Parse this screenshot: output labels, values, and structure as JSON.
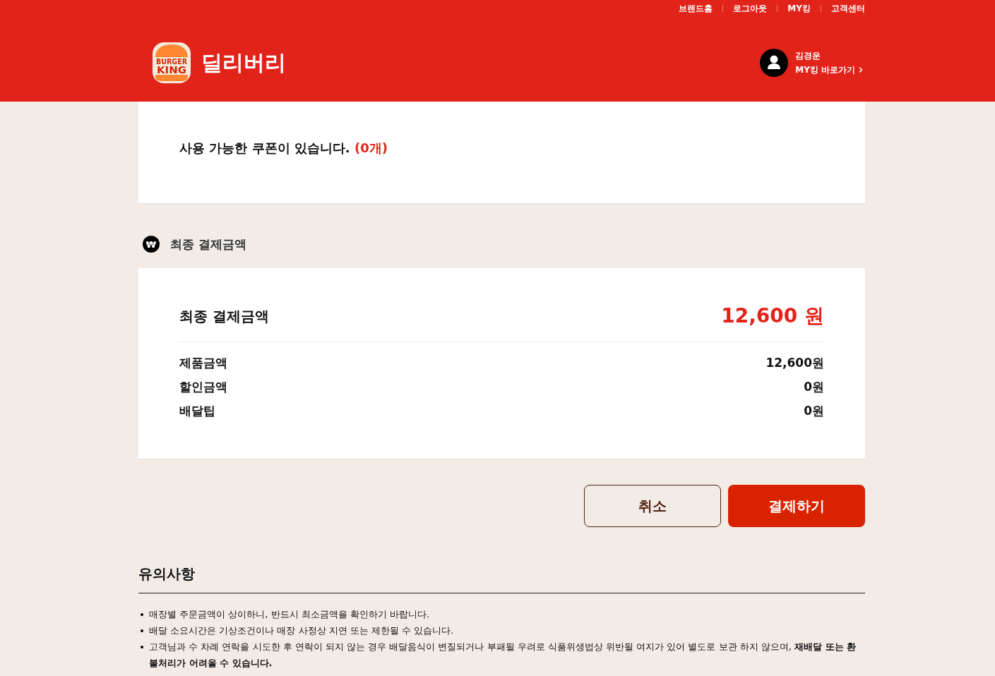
{
  "header": {
    "top_links": [
      "브랜드홈",
      "로그아웃",
      "MY킹",
      "고객센터"
    ],
    "logo": {
      "top": "BURGER",
      "bottom": "KING"
    },
    "title": "딜리버리",
    "user": {
      "name": "김경운",
      "link": "MY킹 바로가기"
    }
  },
  "coupon": {
    "message": "사용 가능한 쿠폰이 있습니다.",
    "count": "(0개)"
  },
  "payment": {
    "heading_icon": "₩",
    "heading": "최종 결제금액",
    "total_label": "최종 결제금액",
    "total_value": "12,600 원",
    "lines": [
      {
        "label": "제품금액",
        "value": "12,600원"
      },
      {
        "label": "할인금액",
        "value": "0원"
      },
      {
        "label": "배달팁",
        "value": "0원"
      }
    ]
  },
  "buttons": [
    {
      "label": "취소",
      "kind": "secondary"
    },
    {
      "label": "결제하기",
      "kind": "primary"
    }
  ],
  "notice": {
    "heading": "유의사항",
    "items": [
      "매장별 주문금액이 상이하니, 반드시 최소금액을 확인하기 바랍니다.",
      "배달 소요시간은 기상조건이나 매장 사정상 지연 또는 제한될 수 있습니다.",
      "고객님과 수 차례 연락을 시도한 후 연락이 되지 않는 경우 배달음식이 변질되거나 부패될 우려로 식품위생법상 위반될 여지가 있어 별도로 보관 하지 않으며, **재배달 또는 환불처리가 어려울 수 있습니다.**"
    ]
  }
}
